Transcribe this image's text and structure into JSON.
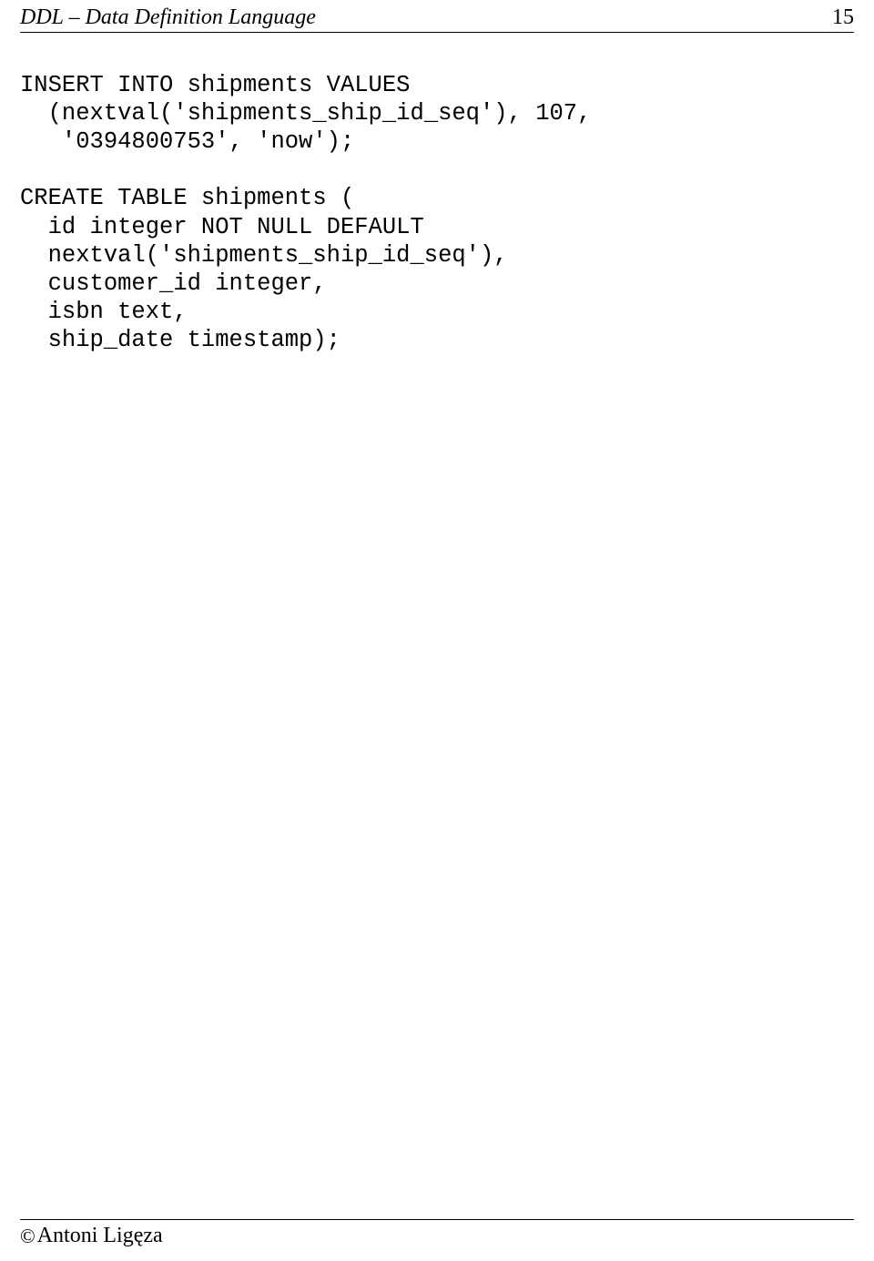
{
  "header": {
    "title": "DDL – Data Definition Language",
    "page": "15"
  },
  "code": {
    "line1": "INSERT INTO shipments VALUES",
    "line2": "  (nextval('shipments_ship_id_seq'), 107,",
    "line3": "   '0394800753', 'now');",
    "line4": "",
    "line5": "CREATE TABLE shipments (",
    "line6": "  id integer NOT NULL DEFAULT",
    "line7": "  nextval('shipments_ship_id_seq'),",
    "line8": "  customer_id integer,",
    "line9": "  isbn text,",
    "line10": "  ship_date timestamp);"
  },
  "footer": {
    "copyright": "©",
    "author": "Antoni Ligęza"
  }
}
